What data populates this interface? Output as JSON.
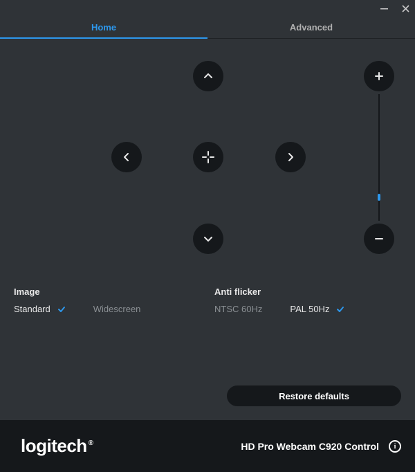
{
  "tabs": {
    "home": "Home",
    "advanced": "Advanced",
    "active": "home"
  },
  "settings": {
    "image": {
      "label": "Image",
      "options": {
        "standard": "Standard",
        "widescreen": "Widescreen"
      },
      "selected": "standard"
    },
    "antiflicker": {
      "label": "Anti flicker",
      "options": {
        "ntsc": "NTSC 60Hz",
        "pal": "PAL 50Hz"
      },
      "selected": "pal"
    }
  },
  "buttons": {
    "restore": "Restore defaults"
  },
  "footer": {
    "brand": "logitech",
    "device": "HD Pro Webcam C920 Control"
  },
  "colors": {
    "accent": "#2d98ed",
    "bg": "#2f3337",
    "dark": "#15181b"
  }
}
